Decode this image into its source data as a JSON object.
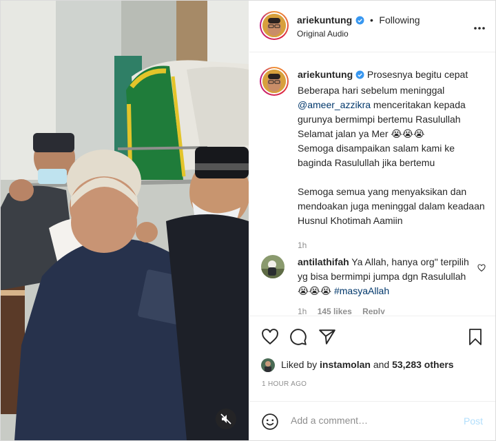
{
  "header": {
    "username": "ariekuntung",
    "separator": "•",
    "follow_status": "Following",
    "audio": "Original Audio"
  },
  "caption": {
    "username": "ariekuntung",
    "line1": "Prosesnya begitu cepat",
    "line2": "Beberapa hari sebelum meninggal",
    "mention": "@ameer_azzikra",
    "line3_rest": " menceritakan kepada gurunya bermimpi bertemu Rasulullah",
    "line4": "Selamat jalan ya Mer 😭😭😭",
    "line5": "Semoga disampaikan salam kami ke baginda Rasulullah jika bertemu",
    "line6": "Semoga semua yang menyaksikan dan mendoakan juga meninggal dalam keadaan Husnul Khotimah Aamiin",
    "time": "1h"
  },
  "comment": {
    "username": "antilathifah",
    "text_before": " Ya Allah, hanya org\" terpilih yg bisa bermimpi jumpa dgn Rasulullah 😭😭😭 ",
    "hashtag": "#masyaAllah",
    "time": "1h",
    "likes": "145 likes",
    "reply": "Reply"
  },
  "likes": {
    "prefix": "Liked by ",
    "liker": "instamolan",
    "middle": " and ",
    "others": "53,283 others"
  },
  "posted_ago": "1 HOUR AGO",
  "add_comment": {
    "placeholder": "Add a comment…",
    "post_label": "Post"
  },
  "icons": {
    "verified": "verified-badge-icon",
    "more": "more-options-icon",
    "like": "heart-icon",
    "comment": "comment-icon",
    "share": "share-icon",
    "save": "bookmark-icon",
    "emoji": "emoji-icon",
    "mute": "muted-speaker-icon"
  },
  "colors": {
    "accent_link": "#00376b",
    "verified": "#3897f0",
    "muted_text": "#8e8e8e",
    "post_disabled": "#b2dffc"
  }
}
